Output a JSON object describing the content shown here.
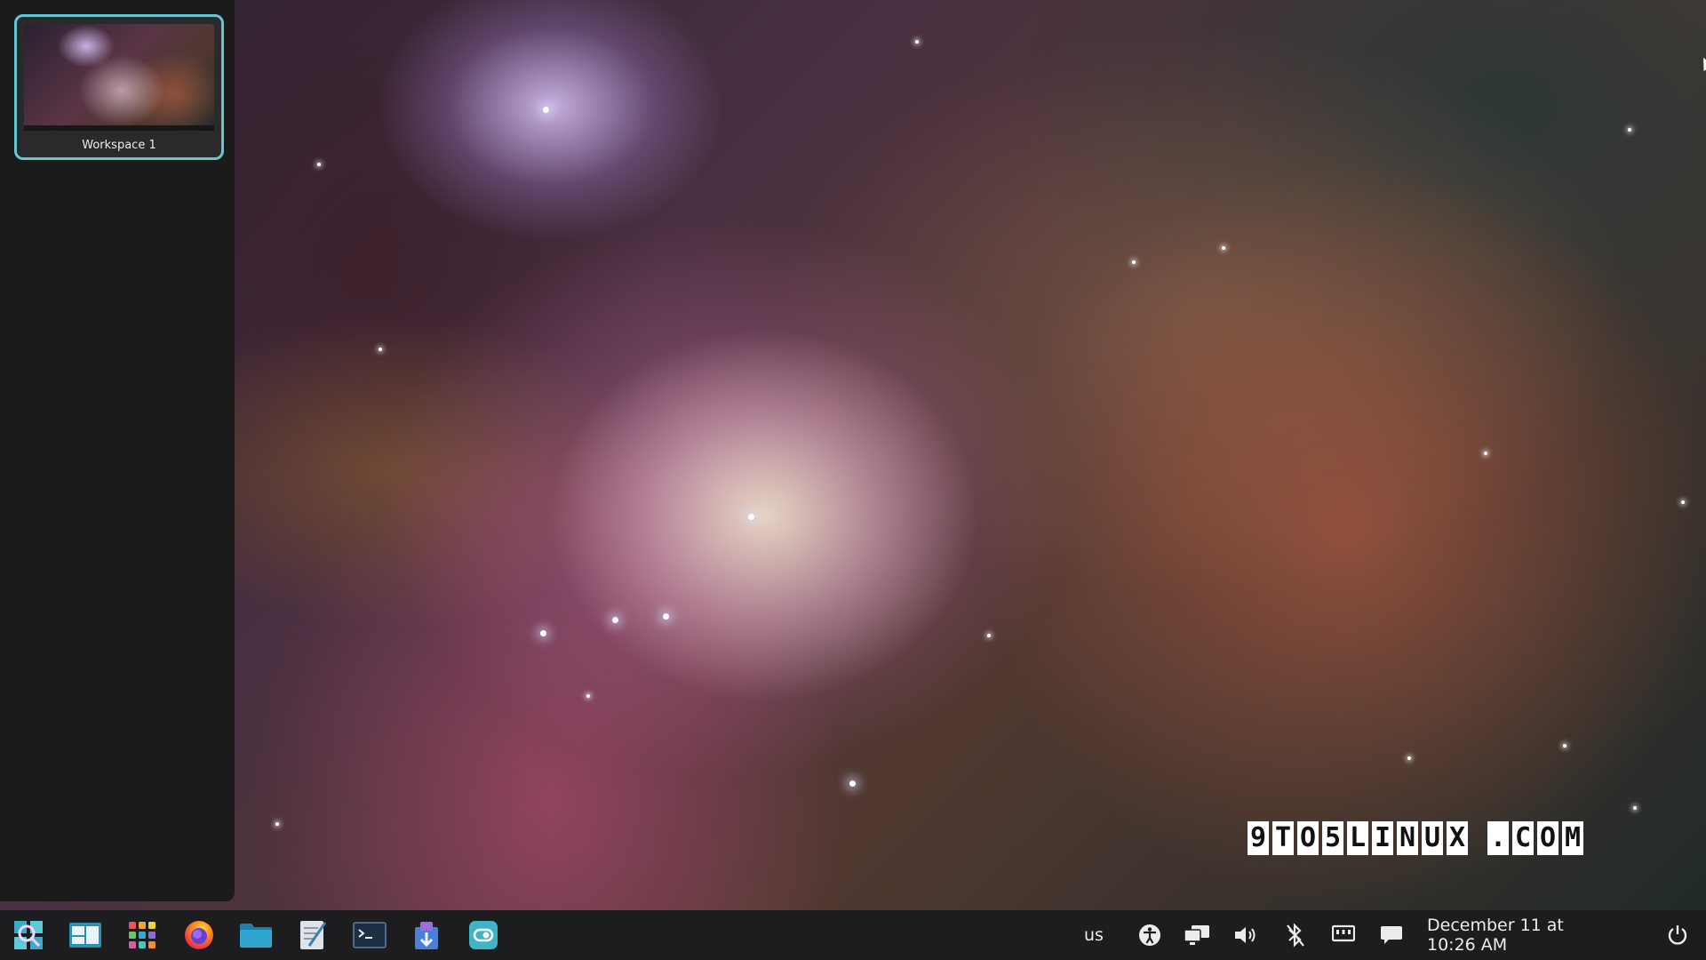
{
  "workspace_panel": {
    "workspaces": [
      {
        "label": "Workspace 1",
        "active": true
      }
    ]
  },
  "desktop": {
    "wallpaper": "orion-nebula",
    "watermark": {
      "site": "9TO5LINUX .COM",
      "chars": [
        "9",
        "T",
        "O",
        "5",
        "L",
        "I",
        "N",
        "U",
        "X",
        " ",
        ".",
        "C",
        "O",
        "M"
      ]
    }
  },
  "taskbar": {
    "dock": [
      {
        "name": "launcher",
        "icon": "launcher-search-icon"
      },
      {
        "name": "workspaces",
        "icon": "workspaces-icon"
      },
      {
        "name": "applications",
        "icon": "app-grid-icon"
      },
      {
        "name": "firefox",
        "icon": "firefox-icon"
      },
      {
        "name": "files",
        "icon": "folder-icon"
      },
      {
        "name": "text-editor",
        "icon": "text-editor-icon"
      },
      {
        "name": "terminal",
        "icon": "terminal-icon"
      },
      {
        "name": "store",
        "icon": "store-icon"
      },
      {
        "name": "settings",
        "icon": "settings-icon"
      }
    ],
    "tray": {
      "keyboard_layout": "us",
      "icons": [
        "accessibility-icon",
        "displays-icon",
        "volume-icon",
        "bluetooth-off-icon",
        "network-icon",
        "notifications-icon"
      ],
      "clock": "December 11 at 10:26 AM",
      "power_icon": "power-icon"
    },
    "accent_color": "#63c7cf",
    "background_color": "#1d1d1f"
  }
}
